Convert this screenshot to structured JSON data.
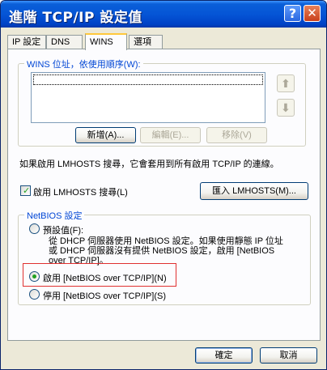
{
  "window": {
    "title": "進階 TCP/IP 設定值",
    "help_symbol": "?",
    "close_symbol": "✕"
  },
  "tabs": [
    {
      "label": "IP 設定",
      "active": false
    },
    {
      "label": "DNS",
      "active": false
    },
    {
      "label": "WINS",
      "active": true
    },
    {
      "label": "選項",
      "active": false
    }
  ],
  "wins": {
    "group_label": "WINS 位址，依使用順序(W):",
    "addresses": [],
    "up_arrow": "⬆",
    "down_arrow": "⬇",
    "add_label": "新增(A)...",
    "edit_label": "編輯(E)...",
    "remove_label": "移除(V)",
    "lmhosts_note": "如果啟用 LMHOSTS 搜尋，它會套用到所有啟用 TCP/IP 的連線。",
    "enable_lmhosts_label": "啟用 LMHOSTS 搜尋(L)",
    "enable_lmhosts_checked": true,
    "import_lmhosts_label": "匯入 LMHOSTS(M)..."
  },
  "netbios": {
    "group_label": "NetBIOS 設定",
    "default_label": "預設值(F):",
    "default_desc_line1": "從 DHCP 伺服器使用 NetBIOS 設定。如果使用靜態 IP 位址",
    "default_desc_line2": "或 DHCP 伺服器沒有提供 NetBIOS 設定，啟用 [NetBIOS",
    "default_desc_line3": "over TCP/IP]。",
    "enable_label": "啟用 [NetBIOS over TCP/IP](N)",
    "disable_label": "停用 [NetBIOS over TCP/IP](S)",
    "selected": "enable"
  },
  "footer": {
    "ok_label": "確定",
    "cancel_label": "取消"
  }
}
